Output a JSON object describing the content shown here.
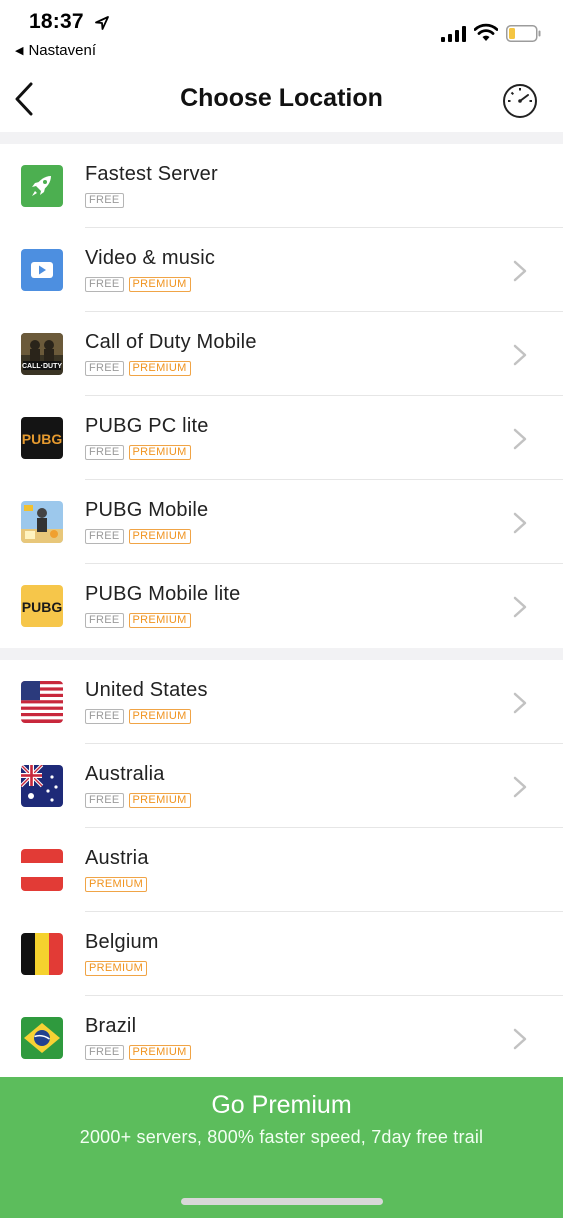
{
  "status_bar": {
    "time": "18:37",
    "back_app": "Nastavení"
  },
  "nav": {
    "title": "Choose Location"
  },
  "badges": {
    "free": "FREE",
    "premium": "PREMIUM"
  },
  "featured": [
    {
      "name": "Fastest Server",
      "icon": "rocket-icon",
      "free": true,
      "premium": false,
      "chevron": false
    },
    {
      "name": "Video & music",
      "icon": "video-play-icon",
      "free": true,
      "premium": true,
      "chevron": true
    },
    {
      "name": "Call of Duty Mobile",
      "icon": "call-of-duty-icon",
      "free": true,
      "premium": true,
      "chevron": true
    },
    {
      "name": "PUBG PC lite",
      "icon": "pubg-pc-icon",
      "free": true,
      "premium": true,
      "chevron": true
    },
    {
      "name": "PUBG Mobile",
      "icon": "pubg-mobile-icon",
      "free": true,
      "premium": true,
      "chevron": true
    },
    {
      "name": "PUBG Mobile lite",
      "icon": "pubg-lite-icon",
      "free": true,
      "premium": true,
      "chevron": true
    }
  ],
  "countries": [
    {
      "name": "United States",
      "icon": "us-flag-icon",
      "free": true,
      "premium": true,
      "chevron": true
    },
    {
      "name": "Australia",
      "icon": "australia-flag-icon",
      "free": true,
      "premium": true,
      "chevron": true
    },
    {
      "name": "Austria",
      "icon": "austria-flag-icon",
      "free": false,
      "premium": true,
      "chevron": false
    },
    {
      "name": "Belgium",
      "icon": "belgium-flag-icon",
      "free": false,
      "premium": true,
      "chevron": false
    },
    {
      "name": "Brazil",
      "icon": "brazil-flag-icon",
      "free": true,
      "premium": true,
      "chevron": true
    }
  ],
  "promo": {
    "title": "Go Premium",
    "subtitle": "2000+ servers, 800% faster speed, 7day free trail"
  },
  "colors": {
    "accent_green": "#5cbd5c",
    "premium_orange": "#f0931e",
    "free_gray": "#9a9a9a"
  }
}
